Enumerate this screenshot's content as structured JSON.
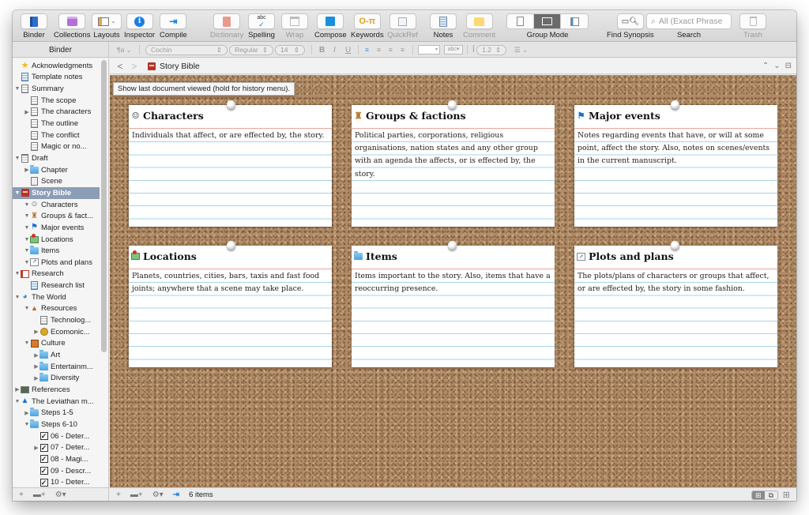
{
  "toolbar": {
    "items": [
      {
        "label": "Binder",
        "icon": "binder-icon",
        "enabled": true
      },
      {
        "label": "Collections",
        "icon": "collections-icon",
        "enabled": true
      },
      {
        "label": "Layouts",
        "icon": "layouts-icon",
        "enabled": true
      },
      {
        "label": "Inspector",
        "icon": "info-icon",
        "enabled": true
      },
      {
        "label": "Compile",
        "icon": "compile-icon",
        "enabled": true
      },
      {
        "label": "Dictionary",
        "icon": "dictionary-icon",
        "enabled": false
      },
      {
        "label": "Spelling",
        "icon": "spelling-icon",
        "enabled": true
      },
      {
        "label": "Wrap",
        "icon": "wrap-icon",
        "enabled": false
      },
      {
        "label": "Compose",
        "icon": "compose-icon",
        "enabled": true
      },
      {
        "label": "Keywords",
        "icon": "key-icon",
        "enabled": true
      },
      {
        "label": "QuickRef",
        "icon": "quickref-icon",
        "enabled": false
      },
      {
        "label": "Notes",
        "icon": "notes-icon",
        "enabled": true
      },
      {
        "label": "Comment",
        "icon": "comment-icon",
        "enabled": false
      },
      {
        "label": "Group Mode",
        "icon": "group-mode-icon",
        "enabled": true
      },
      {
        "label": "Find Synopsis",
        "icon": "find-synopsis-icon",
        "enabled": true
      },
      {
        "label": "Search",
        "icon": "search-icon",
        "enabled": true
      },
      {
        "label": "Trash",
        "icon": "trash-icon",
        "enabled": false
      }
    ],
    "spelling_glyph": "abc",
    "search_placeholder": "All (Exact Phrase",
    "group_mode_active_index": 1
  },
  "formatbar": {
    "binder_header": "Binder",
    "paragraph_style": "¶a",
    "font": "Cochin",
    "weight": "Regular",
    "size": "14",
    "bold": "B",
    "italic": "I",
    "underline": "U",
    "highlight_label": "abc",
    "line_spacing": "1.2"
  },
  "binder": {
    "items": [
      {
        "label": "Acknowledgments",
        "level": 0,
        "toggle": "",
        "icon": "star-icon"
      },
      {
        "label": "Template notes",
        "level": 0,
        "toggle": "",
        "icon": "notes-doc-icon"
      },
      {
        "label": "Summary",
        "level": 0,
        "toggle": "▼",
        "icon": "document-stack-icon"
      },
      {
        "label": "The scope",
        "level": 1,
        "toggle": "",
        "icon": "document-icon"
      },
      {
        "label": "The characters",
        "level": 1,
        "toggle": "▶",
        "icon": "document-icon"
      },
      {
        "label": "The outline",
        "level": 1,
        "toggle": "",
        "icon": "document-icon"
      },
      {
        "label": "The conflict",
        "level": 1,
        "toggle": "",
        "icon": "document-icon"
      },
      {
        "label": "Magic or no...",
        "level": 1,
        "toggle": "",
        "icon": "document-icon"
      },
      {
        "label": "Draft",
        "level": 0,
        "toggle": "▼",
        "icon": "draft-icon"
      },
      {
        "label": "Chapter",
        "level": 1,
        "toggle": "▶",
        "icon": "folder-icon"
      },
      {
        "label": "Scene",
        "level": 1,
        "toggle": "",
        "icon": "scene-icon"
      },
      {
        "label": "Story Bible",
        "level": 0,
        "toggle": "▼",
        "icon": "story-bible-icon",
        "selected": true
      },
      {
        "label": "Characters",
        "level": 1,
        "toggle": "▼",
        "icon": "mask-icon"
      },
      {
        "label": "Groups & fact...",
        "level": 1,
        "toggle": "▼",
        "icon": "crest-icon"
      },
      {
        "label": "Major events",
        "level": 1,
        "toggle": "▼",
        "icon": "flag-icon"
      },
      {
        "label": "Locations",
        "level": 1,
        "toggle": "▼",
        "icon": "map-pin-icon"
      },
      {
        "label": "Items",
        "level": 1,
        "toggle": "▼",
        "icon": "folder-icon"
      },
      {
        "label": "Plots and plans",
        "level": 1,
        "toggle": "▼",
        "icon": "chart-icon"
      },
      {
        "label": "Research",
        "level": 0,
        "toggle": "▼",
        "icon": "research-icon"
      },
      {
        "label": "Research list",
        "level": 1,
        "toggle": "",
        "icon": "notes-doc-icon"
      },
      {
        "label": "The World",
        "level": 0,
        "toggle": "▼",
        "icon": "globe-icon"
      },
      {
        "label": "Resources",
        "level": 1,
        "toggle": "▼",
        "icon": "mountain-icon"
      },
      {
        "label": "Technolog...",
        "level": 2,
        "toggle": "",
        "icon": "document-icon"
      },
      {
        "label": "Ecomonic...",
        "level": 2,
        "toggle": "▶",
        "icon": "coin-icon"
      },
      {
        "label": "Culture",
        "level": 1,
        "toggle": "▼",
        "icon": "culture-icon"
      },
      {
        "label": "Art",
        "level": 2,
        "toggle": "▶",
        "icon": "folder-icon"
      },
      {
        "label": "Entertainm...",
        "level": 2,
        "toggle": "▶",
        "icon": "folder-icon"
      },
      {
        "label": "Diversity",
        "level": 2,
        "toggle": "▶",
        "icon": "folder-icon"
      },
      {
        "label": "References",
        "level": 0,
        "toggle": "▶",
        "icon": "chalkboard-icon"
      },
      {
        "label": "The Leviathan m...",
        "level": 0,
        "toggle": "▼",
        "icon": "warning-icon"
      },
      {
        "label": "Steps 1-5",
        "level": 1,
        "toggle": "▶",
        "icon": "folder-icon"
      },
      {
        "label": "Steps 6-10",
        "level": 1,
        "toggle": "▼",
        "icon": "folder-icon"
      },
      {
        "label": "06 - Deter...",
        "level": 2,
        "toggle": "",
        "icon": "checkbox-icon"
      },
      {
        "label": "07 - Deter...",
        "level": 2,
        "toggle": "▶",
        "icon": "checkbox-icon"
      },
      {
        "label": "08 - Magi...",
        "level": 2,
        "toggle": "",
        "icon": "checkbox-icon"
      },
      {
        "label": "09 - Descr...",
        "level": 2,
        "toggle": "",
        "icon": "checkbox-icon"
      },
      {
        "label": "10 - Deter...",
        "level": 2,
        "toggle": "",
        "icon": "checkbox-icon"
      }
    ],
    "footer": {
      "add": "+",
      "add_folder": "▬+",
      "settings": "⚙▾"
    }
  },
  "editor": {
    "back": "<",
    "forward": ">",
    "title": "Story Bible",
    "tooltip": "Show last document viewed (hold for history menu).",
    "header_up": "^",
    "header_down": "v"
  },
  "cards": [
    {
      "title": "Characters",
      "icon": "mask-icon",
      "glyph": "☺",
      "synopsis": "Individuals that affect, or are effected by, the story."
    },
    {
      "title": "Groups & factions",
      "icon": "crest-icon",
      "glyph": "♜",
      "synopsis": "Political parties, corporations, religious organisations, nation states and any other group with an agenda the affects, or is effected by, the story."
    },
    {
      "title": "Major events",
      "icon": "flag-icon",
      "glyph": "⚑",
      "synopsis": "Notes regarding events that have, or will at some point, affect the story. Also, notes on scenes/events in the current manuscript."
    },
    {
      "title": "Locations",
      "icon": "map-pin-icon",
      "glyph": "📍",
      "synopsis": "Planets, countries, cities, bars, taxis and fast food joints; anywhere that a scene may take place."
    },
    {
      "title": "Items",
      "icon": "folder-icon",
      "glyph": "",
      "synopsis": "Items important to the story. Also, items that have a reoccurring presence."
    },
    {
      "title": "Plots and plans",
      "icon": "chart-icon",
      "glyph": "📈",
      "synopsis": "The plots/plans of characters or groups that affect, or are effected by, the story in some fashion."
    }
  ],
  "footer": {
    "add": "+",
    "add_folder": "▬+",
    "settings": "⚙▾",
    "item_count": "6 items"
  },
  "colors": {
    "selection": "#8c9db6",
    "card_redline": "#e8a69b",
    "card_blueline": "#a8d3e6",
    "cork": "#b08b66",
    "accent_blue": "#1a7ee8"
  }
}
